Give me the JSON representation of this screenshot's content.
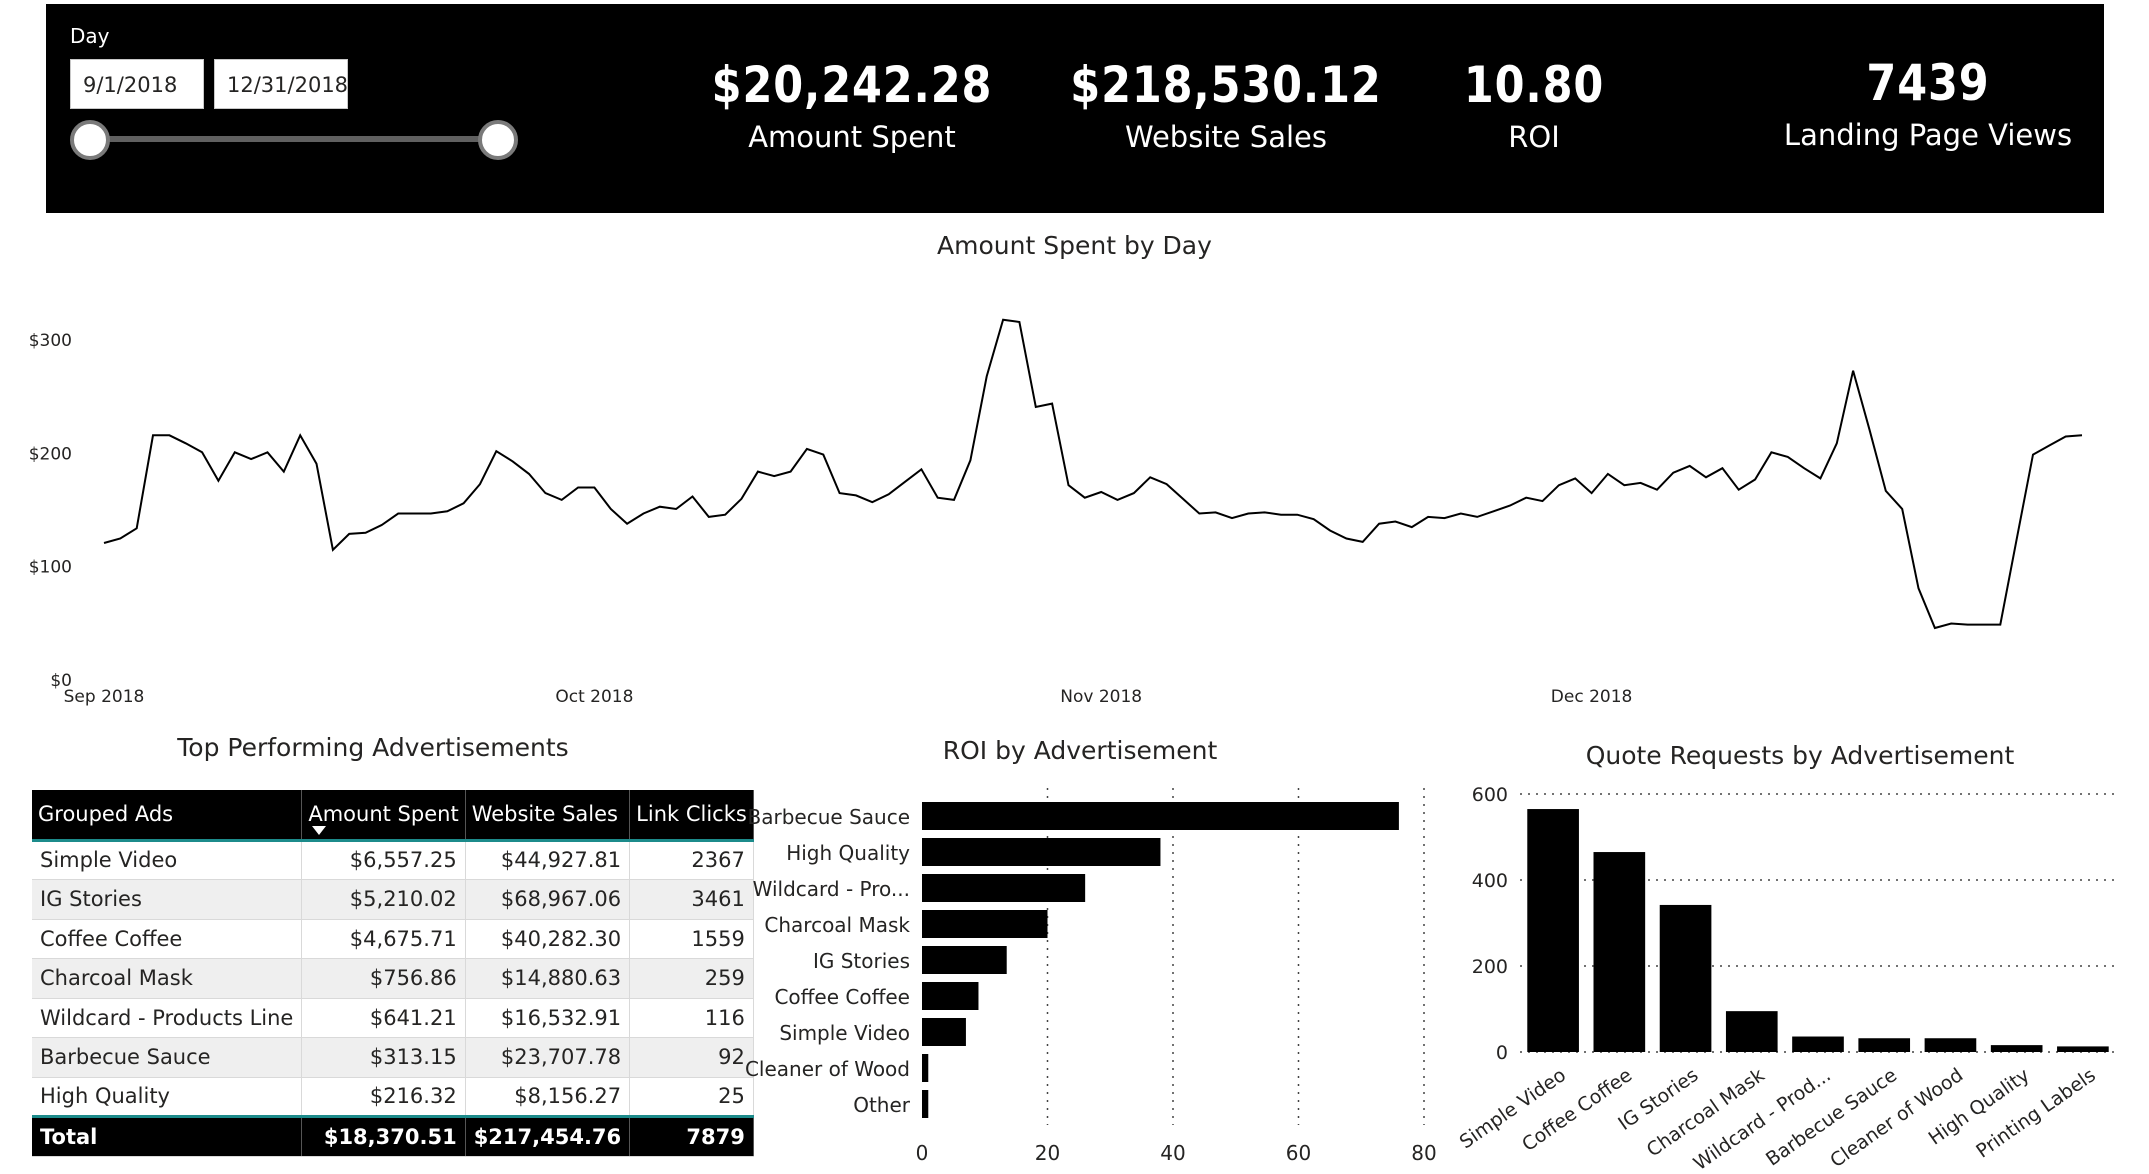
{
  "header": {
    "slicer": {
      "title": "Day",
      "start_date": "9/1/2018",
      "end_date": "12/31/2018"
    },
    "kpis": [
      {
        "value": "$20,242.28",
        "label": "Amount Spent"
      },
      {
        "value": "$218,530.12",
        "label": "Website Sales"
      },
      {
        "value": "10.80",
        "label": "ROI"
      },
      {
        "value": "7439",
        "label": "Landing Page Views"
      }
    ]
  },
  "chart_data": [
    {
      "type": "line",
      "title": "Amount Spent by Day",
      "xlabel": "",
      "ylabel": "",
      "x_tick_labels": [
        "Sep 2018",
        "Oct 2018",
        "Nov 2018",
        "Dec 2018"
      ],
      "y_tick_labels": [
        "$0",
        "$100",
        "$200",
        "$300"
      ],
      "ylim": [
        0,
        300
      ],
      "x_start": "2018-09-01",
      "y_values": [
        120,
        124,
        133,
        215,
        215,
        208,
        200,
        175,
        200,
        194,
        200,
        183,
        215,
        190,
        114,
        128,
        129,
        136,
        146,
        146,
        146,
        148,
        155,
        172,
        201,
        192,
        181,
        164,
        158,
        169,
        169,
        150,
        137,
        146,
        152,
        150,
        161,
        143,
        145,
        159,
        183,
        179,
        183,
        203,
        198,
        164,
        162,
        156,
        163,
        174,
        185,
        160,
        158,
        193,
        267,
        317,
        315,
        240,
        243,
        171,
        160,
        165,
        158,
        164,
        178,
        172,
        159,
        146,
        147,
        142,
        146,
        147,
        145,
        145,
        141,
        131,
        124,
        121,
        137,
        139,
        134,
        143,
        142,
        146,
        143,
        148,
        153,
        160,
        157,
        171,
        177,
        164,
        181,
        171,
        173,
        167,
        182,
        188,
        178,
        186,
        167,
        176,
        200,
        196,
        186,
        177,
        208,
        272,
        220,
        166,
        150,
        80,
        45,
        49,
        48,
        48,
        48,
        123,
        198,
        206,
        214,
        215
      ]
    },
    {
      "type": "bar",
      "orientation": "horizontal",
      "title": "ROI by Advertisement",
      "categories": [
        "Barbecue Sauce",
        "High Quality",
        "Wildcard - Pro...",
        "Charcoal Mask",
        "IG Stories",
        "Coffee Coffee",
        "Simple Video",
        "Cleaner of Wood",
        "Other"
      ],
      "values": [
        76,
        38,
        26,
        20,
        13.5,
        9,
        7,
        1,
        1
      ],
      "xlim": [
        0,
        80
      ],
      "x_ticks": [
        0,
        20,
        40,
        60,
        80
      ]
    },
    {
      "type": "bar",
      "title": "Quote Requests by Advertisement",
      "categories": [
        "Simple Video",
        "Coffee Coffee",
        "IG Stories",
        "Charcoal Mask",
        "Wildcard - Prod...",
        "Barbecue Sauce",
        "Cleaner of Wood",
        "High Quality",
        "Printing Labels"
      ],
      "values": [
        565,
        465,
        342,
        95,
        36,
        32,
        32,
        16,
        13
      ],
      "ylim": [
        0,
        600
      ],
      "y_ticks": [
        0,
        200,
        400,
        600
      ]
    }
  ],
  "table": {
    "title": "Top Performing Advertisements",
    "headers": [
      "Grouped Ads",
      "Amount Spent",
      "Website Sales",
      "Link Clicks"
    ],
    "rows": [
      [
        "Simple Video",
        "$6,557.25",
        "$44,927.81",
        "2367"
      ],
      [
        "IG Stories",
        "$5,210.02",
        "$68,967.06",
        "3461"
      ],
      [
        "Coffee Coffee",
        "$4,675.71",
        "$40,282.30",
        "1559"
      ],
      [
        "Charcoal Mask",
        "$756.86",
        "$14,880.63",
        "259"
      ],
      [
        "Wildcard - Products Line",
        "$641.21",
        "$16,532.91",
        "116"
      ],
      [
        "Barbecue Sauce",
        "$313.15",
        "$23,707.78",
        "92"
      ],
      [
        "High Quality",
        "$216.32",
        "$8,156.27",
        "25"
      ]
    ],
    "total": [
      "Total",
      "$18,370.51",
      "$217,454.76",
      "7879"
    ]
  }
}
